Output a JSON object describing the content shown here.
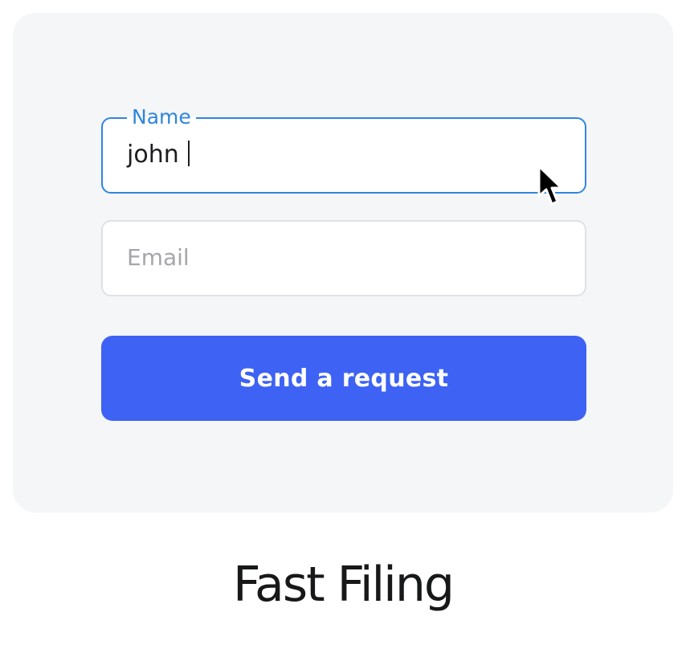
{
  "form": {
    "name_field": {
      "label": "Name",
      "value": "john "
    },
    "email_field": {
      "placeholder": "Email"
    },
    "submit_label": "Send a request"
  },
  "brand": {
    "name": "Fast Filing"
  },
  "colors": {
    "accent": "#3d62f4",
    "focus": "#2f86de",
    "card_bg": "#f5f6f8",
    "text": "#17181a",
    "placeholder": "#a4a6aa"
  },
  "icons": {
    "cursor": "mouse-pointer-icon"
  }
}
